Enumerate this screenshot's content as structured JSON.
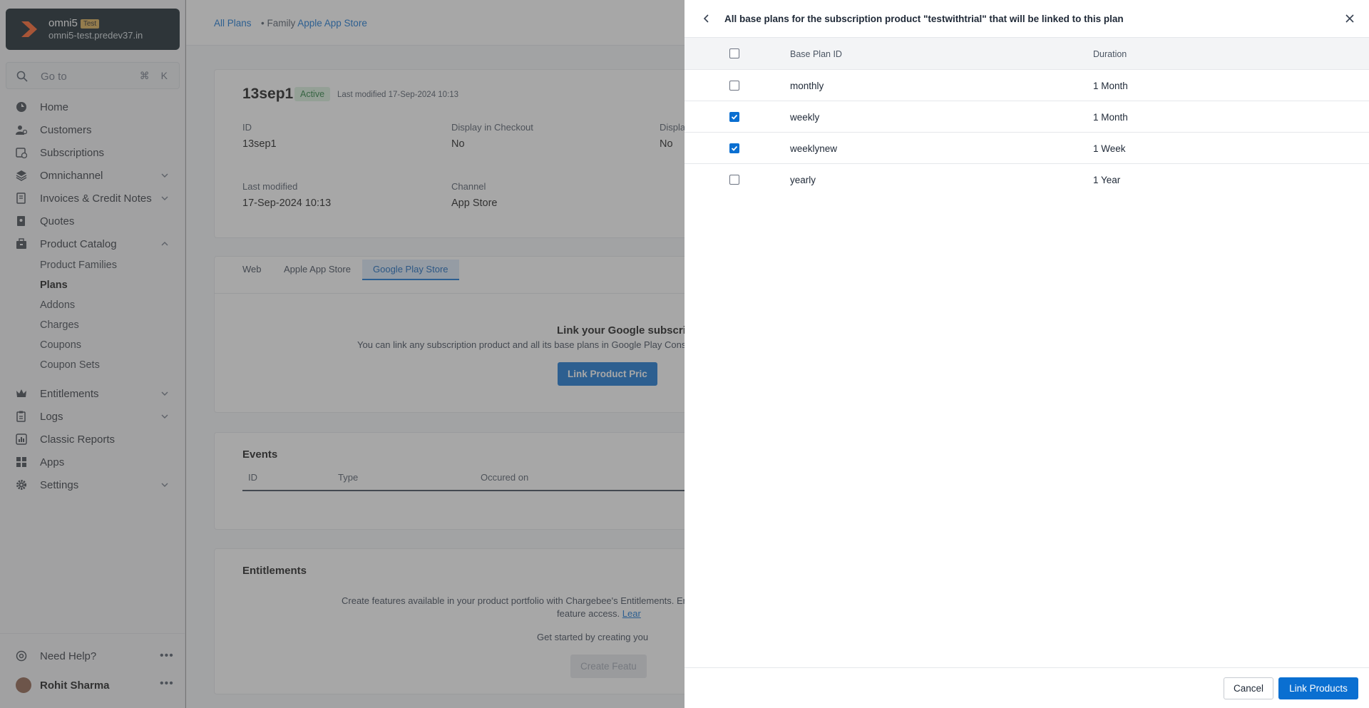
{
  "brand": {
    "name": "omni5",
    "tag": "Test",
    "domain": "omni5-test.predev37.in"
  },
  "goto": {
    "placeholder": "Go to",
    "shortcut": "⌘ K"
  },
  "nav": {
    "home": "Home",
    "customers": "Customers",
    "subscriptions": "Subscriptions",
    "omnichannel": "Omnichannel",
    "invoices": "Invoices & Credit Notes",
    "quotes": "Quotes",
    "product_catalog": "Product Catalog",
    "sub": {
      "product_families": "Product Families",
      "plans": "Plans",
      "addons": "Addons",
      "charges": "Charges",
      "coupons": "Coupons",
      "coupon_sets": "Coupon Sets"
    },
    "entitlements": "Entitlements",
    "logs": "Logs",
    "classic_reports": "Classic Reports",
    "apps": "Apps",
    "settings": "Settings"
  },
  "footer": {
    "help": "Need Help?",
    "user": "Rohit Sharma"
  },
  "breadcrumb": {
    "all_plans": "All Plans",
    "family_label": "Family",
    "family_value": "Apple App Store"
  },
  "plan": {
    "title": "13sep1",
    "status": "Active",
    "last_modified_short": "Last modified 17-Sep-2024 10:13",
    "id_label": "ID",
    "id_value": "13sep1",
    "display_checkout_label": "Display in Checkout",
    "display_checkout_value": "No",
    "display_other_label": "Displa",
    "display_other_value": "No",
    "last_modified_label": "Last modified",
    "last_modified_value": "17-Sep-2024 10:13",
    "channel_label": "Channel",
    "channel_value": "App Store"
  },
  "store_tabs": {
    "web": "Web",
    "apple": "Apple App Store",
    "google": "Google Play Store"
  },
  "google": {
    "heading": "Link your Google subscrip",
    "desc": "You can link any subscription product and all its base plans in Google Play Consol",
    "button": "Link Product Pric"
  },
  "events": {
    "title": "Events",
    "col_id": "ID",
    "col_type": "Type",
    "col_occured": "Occured on"
  },
  "entitlements_card": {
    "title": "Entitlements",
    "desc1": "Create features available in your product portfolio with Chargebee's Entitlements. Enjo",
    "desc2": "feature access.",
    "learn": "Lear",
    "getstarted": "Get started by creating you",
    "button": "Create Featu"
  },
  "drawer": {
    "title": "All base plans for the subscription product \"testwithtrial\" that will be linked to this plan",
    "col_id": "Base Plan ID",
    "col_duration": "Duration",
    "rows": [
      {
        "id": "monthly",
        "duration": "1 Month",
        "checked": false
      },
      {
        "id": "weekly",
        "duration": "1 Month",
        "checked": true
      },
      {
        "id": "weeklynew",
        "duration": "1 Week",
        "checked": true
      },
      {
        "id": "yearly",
        "duration": "1 Year",
        "checked": false
      }
    ],
    "cancel": "Cancel",
    "submit": "Link Products"
  },
  "colors": {
    "accent": "#0a6fd1",
    "brand_bg": "#0d1b22",
    "active_badge": "#d9f0dd"
  }
}
